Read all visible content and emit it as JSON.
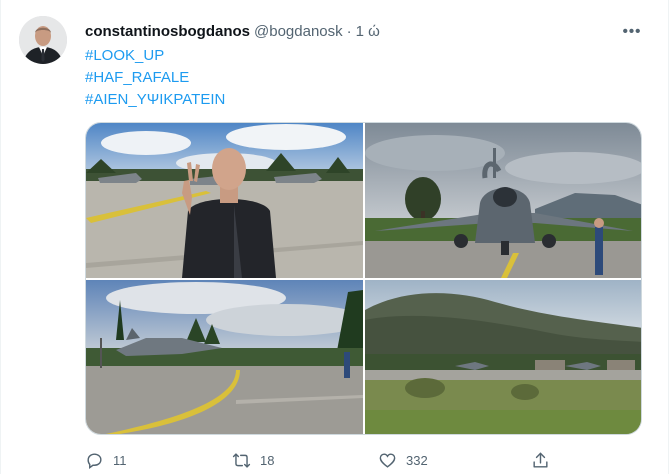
{
  "tweet": {
    "display_name": "constantinosbogdanos",
    "handle": "@bogdanosk",
    "separator": "·",
    "time": "1 ώ",
    "more_label": "•••",
    "hashtags": [
      "#LOOK_UP",
      "#HAF_RAFALE",
      "#ΑΙΕΝ_ΥΨΙΚΡΑΤΕΙΝ"
    ],
    "media": [
      {
        "icon": "photo-airbase-man-victory-sign"
      },
      {
        "icon": "photo-rafale-jet-front"
      },
      {
        "icon": "photo-rafale-taxiway"
      },
      {
        "icon": "photo-airfield-mountain"
      }
    ],
    "actions": {
      "reply": {
        "icon": "reply-icon",
        "count": "11"
      },
      "retweet": {
        "icon": "retweet-icon",
        "count": "18"
      },
      "like": {
        "icon": "heart-icon",
        "count": "332"
      },
      "share": {
        "icon": "share-icon"
      }
    }
  },
  "colors": {
    "link": "#1d9bf0",
    "secondary_text": "#536471",
    "primary_text": "#0f1419",
    "border": "#cfd9de"
  }
}
